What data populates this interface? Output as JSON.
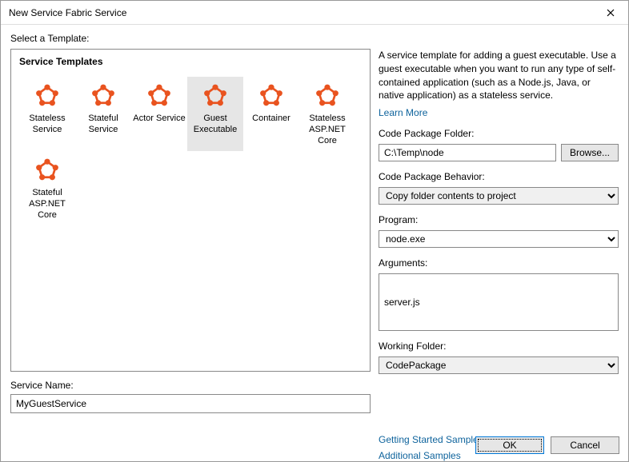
{
  "window": {
    "title": "New Service Fabric Service"
  },
  "select_label": "Select a Template:",
  "templates_title": "Service Templates",
  "templates": [
    {
      "label": "Stateless Service"
    },
    {
      "label": "Stateful Service"
    },
    {
      "label": "Actor Service"
    },
    {
      "label": "Guest Executable",
      "selected": true
    },
    {
      "label": "Container"
    },
    {
      "label": "Stateless ASP.NET Core"
    },
    {
      "label": "Stateful ASP.NET Core"
    }
  ],
  "service_name_label": "Service Name:",
  "service_name_value": "MyGuestService",
  "right": {
    "description": "A service template for adding a guest executable. Use a guest executable when you want to run any type of self-contained application (such as a Node.js, Java, or native application) as a stateless service.",
    "learn_more": "Learn More",
    "code_folder_label": "Code Package Folder:",
    "code_folder_value": "C:\\Temp\\node",
    "browse": "Browse...",
    "behavior_label": "Code Package Behavior:",
    "behavior_value": "Copy folder contents to project",
    "program_label": "Program:",
    "program_value": "node.exe",
    "arguments_label": "Arguments:",
    "arguments_value": "server.js",
    "working_folder_label": "Working Folder:",
    "working_folder_value": "CodePackage",
    "getting_started": "Getting Started Sample",
    "additional_samples": "Additional Samples"
  },
  "footer": {
    "ok": "OK",
    "cancel": "Cancel"
  },
  "colors": {
    "accent": "#e9531f"
  }
}
